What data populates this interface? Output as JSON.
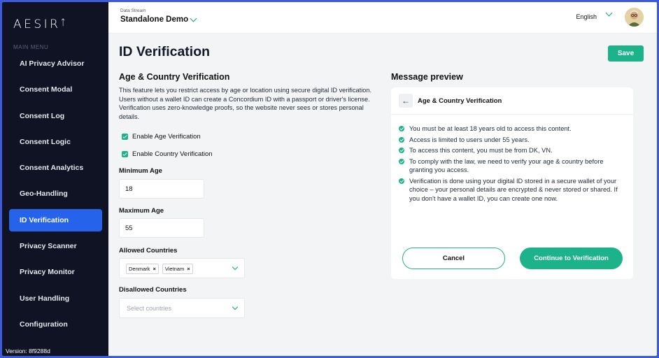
{
  "app": {
    "logo_text": "AESIR",
    "menu_heading": "MAIN MENU",
    "version": "Version: 8f9288d"
  },
  "sidebar": {
    "items": [
      {
        "label": "AI Privacy Advisor",
        "active": false
      },
      {
        "label": "Consent Modal",
        "active": false
      },
      {
        "label": "Consent Log",
        "active": false
      },
      {
        "label": "Consent Logic",
        "active": false
      },
      {
        "label": "Consent Analytics",
        "active": false
      },
      {
        "label": "Geo-Handling",
        "active": false
      },
      {
        "label": "ID Verification",
        "active": true
      },
      {
        "label": "Privacy Scanner",
        "active": false
      },
      {
        "label": "Privacy Monitor",
        "active": false
      },
      {
        "label": "User Handling",
        "active": false
      },
      {
        "label": "Configuration",
        "active": false
      }
    ]
  },
  "header": {
    "stream_label": "Data Stream",
    "stream_value": "Standalone Demo",
    "language": "English"
  },
  "page": {
    "title": "ID Verification",
    "save_label": "Save"
  },
  "verification": {
    "title": "Age & Country Verification",
    "description": "This feature lets you restrict access by age or location using secure digital ID verification. Users without a wallet ID can create a Concordium ID with a passport or driver's license. Verification uses zero-knowledge proofs, so the website never sees or stores personal details.",
    "enable_age_label": "Enable Age Verification",
    "enable_country_label": "Enable Country Verification",
    "min_age_label": "Minimum Age",
    "min_age_value": "18",
    "max_age_label": "Maximum Age",
    "max_age_value": "55",
    "allowed_label": "Allowed Countries",
    "allowed_tags": [
      "Denmark",
      "Vietnam"
    ],
    "disallowed_label": "Disallowed Countries",
    "disallowed_placeholder": "Select countries"
  },
  "preview": {
    "title": "Message preview",
    "card_title": "Age & Country Verification",
    "items": [
      "You must be at least 18 years old to access this content.",
      "Access is limited to users under 55 years.",
      "To access this content, you must be from DK, VN.",
      "To comply with the law, we need to verify your age & country before granting you access.",
      "Verification is done using your digital ID stored in a secure wallet of your choice – your personal details are encrypted & never stored or shared. If you don't have a wallet ID, you can create one now."
    ],
    "cancel_label": "Cancel",
    "continue_label": "Continue to Verification"
  },
  "colors": {
    "accent": "#1db38a",
    "sidebar_bg": "#0f1324",
    "active_item": "#2563eb",
    "frame": "#3b5bdb"
  }
}
